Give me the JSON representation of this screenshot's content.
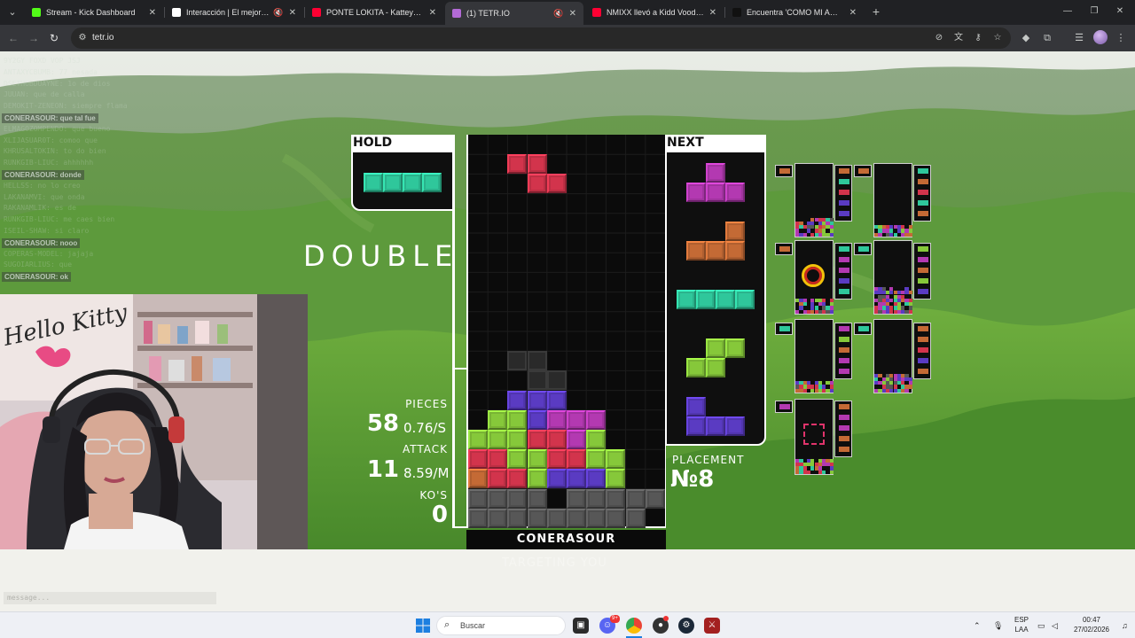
{
  "browser": {
    "tabs": [
      {
        "title": "Stream - Kick Dashboard",
        "favicon": "kick-icon",
        "color": "#53fc18",
        "active": false,
        "muted": false
      },
      {
        "title": "Interacción | El mejor software",
        "favicon": "obs-icon",
        "color": "#ffffff",
        "active": false,
        "muted": true
      },
      {
        "title": "PONTE LOKITA - Katteyes x Kidd",
        "favicon": "youtube-icon",
        "color": "#ff0033",
        "active": false,
        "muted": false
      },
      {
        "title": "(1) TETR.IO",
        "favicon": "tetrio-icon",
        "color": "#b36ad6",
        "active": true,
        "muted": true
      },
      {
        "title": "NMIXX llevó a Kidd Voodoo al lim",
        "favicon": "youtube-icon",
        "color": "#ff0033",
        "active": false,
        "muted": false
      },
      {
        "title": "Encuentra 'COMO MI AMIGO CU",
        "favicon": "tiktok-icon",
        "color": "#111111",
        "active": false,
        "muted": false
      }
    ],
    "new_tab_icon": "plus-icon",
    "url": "tetr.io"
  },
  "chat": {
    "lines": [
      "9Y2GY FOXD VOP JSJ",
      "ANTAXYCBUMB: 77 nesada",
      "DSETHUBDUAYNE: 1o de dios",
      "JUUAN: que de calla",
      "DEMOKIT-ZENEON: siempre flama",
      "CONERASOUR: que tal fue",
      "ELMAGOZOMPENDO: que bueno",
      "XLIJASUAR0T: comoo que",
      "KHRUSALTOKIN: to do bien",
      "RUNKGIB-LIUC: ahhhhhh",
      "CONERASOUR: donde",
      "HELLSS: no lo creo",
      "LAKANAMVI: que onda",
      "RAKANAMLIK: es de",
      "RUNKGIB-LIUC: me caes bien",
      "ISEIL-SHAW: si claro",
      "CONERASOUR: nooo",
      "COPERAS-MODEL: jajaja",
      "SUGOIARLIUS: que",
      "CONERASOUR: ok"
    ],
    "highlight_name": "CONERASOUR",
    "input_placeholder": "message..."
  },
  "game": {
    "hold_label": "HOLD",
    "next_label": "NEXT",
    "clear_text": "DOUBLE",
    "pieces_label": "PIECES",
    "pieces_value": "58",
    "pieces_rate": "0.76/S",
    "attack_label": "ATTACK",
    "attack_value": "11",
    "attack_rate": "8.59/M",
    "kos_label": "KO'S",
    "kos_value": "0",
    "placement_label": "PLACEMENT",
    "placement_value": "№8",
    "player_name": "CONERASOUR",
    "targeting_text": "TARGETING YOU",
    "hold_piece": "I",
    "next_queue": [
      "T",
      "L",
      "I",
      "S",
      "J"
    ],
    "colors": {
      "I": "#2fc79b",
      "T": "#b339b1",
      "L": "#c46a35",
      "S": "#86c83a",
      "Z": "#d2344c",
      "J": "#5a3bc2",
      "G": "#575757"
    },
    "falling_piece": "Z",
    "ghost_piece": "Z",
    "board_rows": [
      "..JJJ.....",
      ".SSJTTT...",
      "SSSZZTS...",
      "ZZSSZZSS..",
      "LZZSJJJS..",
      "GGGG.GGGGG",
      "GGGGGGGGG."
    ]
  },
  "taskbar": {
    "search_label": "Buscar",
    "search_icon": "search-icon",
    "apps": [
      "windows-start-icon",
      "task-view-icon",
      "discord-icon",
      "chrome-icon",
      "obs-icon",
      "steam-icon",
      "dota-icon"
    ],
    "discord_badge": "9+",
    "language_top": "ESP",
    "language_bottom": "LAA",
    "time": "00:47",
    "date": "27/02/2026"
  }
}
